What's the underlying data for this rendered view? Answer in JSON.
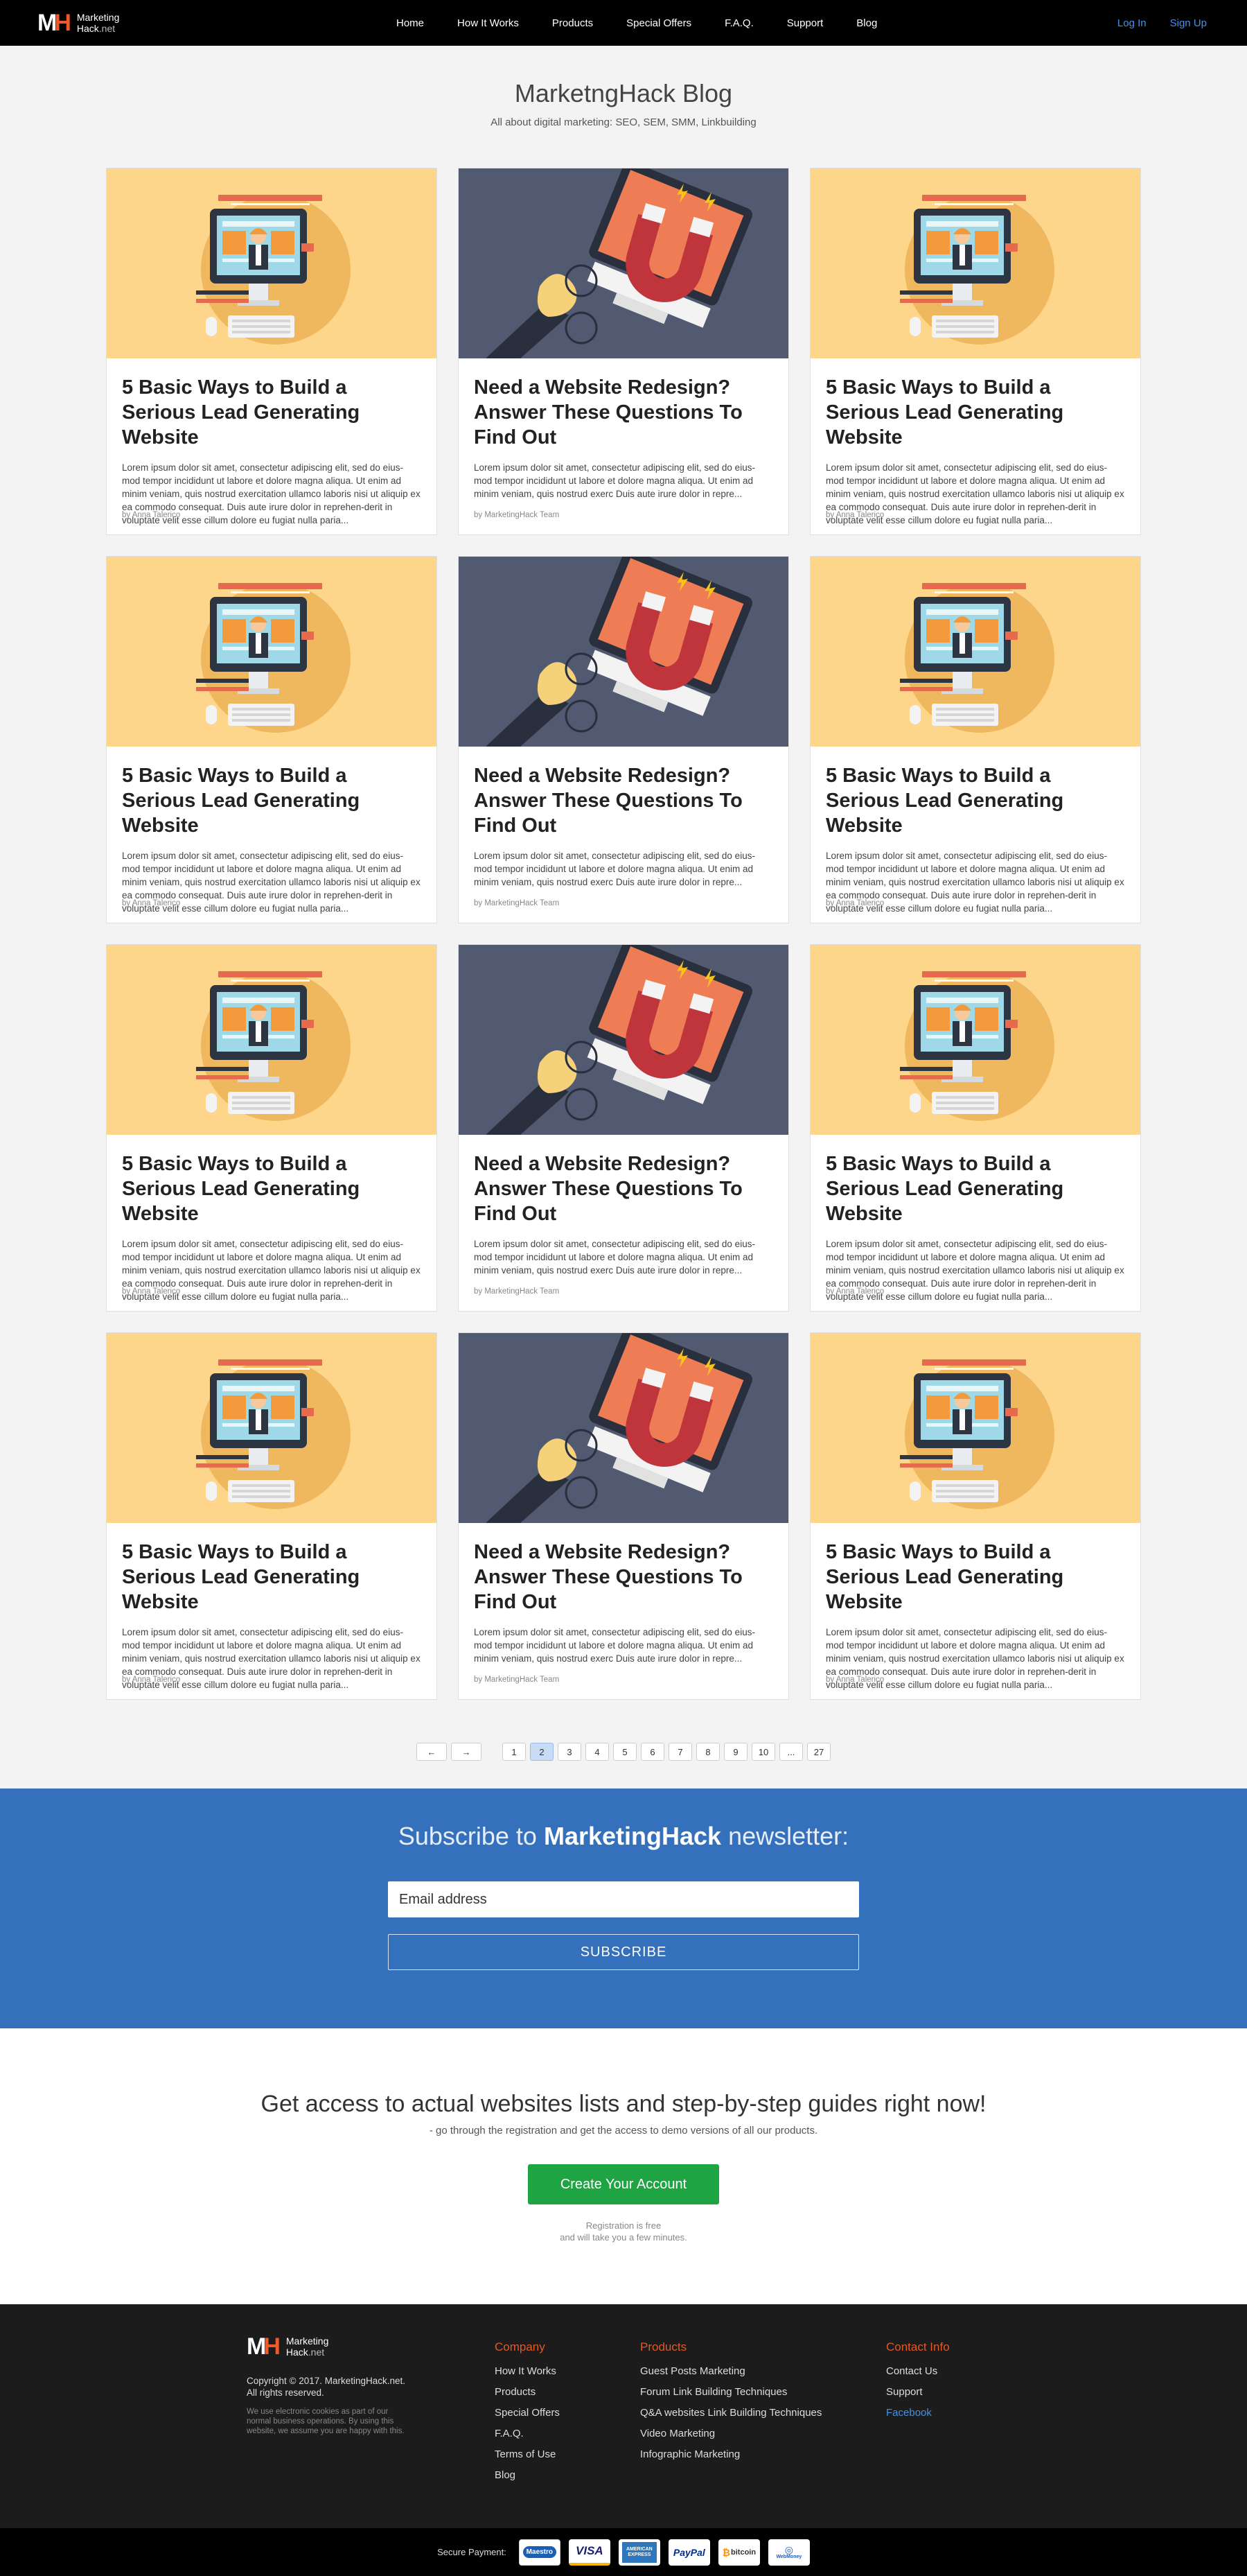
{
  "header": {
    "logo_line1": "Marketing",
    "logo_line2a": "Hack",
    "logo_line2b": ".net",
    "nav": [
      "Home",
      "How It Works",
      "Products",
      "Special Offers",
      "F.A.Q.",
      "Support",
      "Blog"
    ],
    "login": "Log In",
    "signup": "Sign Up"
  },
  "blog": {
    "title": "MarketngHack Blog",
    "subtitle": "All about digital marketing: SEO, SEM, SMM, Linkbuilding"
  },
  "posts": [
    {
      "title": "5 Basic Ways to Build a Serious Lead Generating Website",
      "excerpt": "Lorem ipsum dolor sit amet, consectetur adipiscing elit, sed do eius-mod tempor incididunt ut labore et dolore magna aliqua. Ut enim ad minim veniam, quis nostrud exercitation ullamco laboris nisi ut aliquip ex ea commodo consequat. Duis aute irure dolor in reprehen-derit in voluptate velit esse cillum dolore eu fugiat nulla paria...",
      "author": "by Anna Talerico",
      "image": "developer-illustration"
    },
    {
      "title": "Need a Website Redesign? Answer These Questions To Find Out",
      "excerpt": "Lorem ipsum dolor sit amet, consectetur adipiscing elit, sed do eius-mod tempor incididunt ut labore et dolore magna aliqua. Ut enim ad minim veniam, quis nostrud exerc Duis aute irure dolor in repre...",
      "author": "by MarketingHack Team",
      "image": "magnet-illustration"
    },
    {
      "title": "5 Basic Ways to Build a Serious Lead Generating Website",
      "excerpt": "Lorem ipsum dolor sit amet, consectetur adipiscing elit, sed do eius-mod tempor incididunt ut labore et dolore magna aliqua. Ut enim ad minim veniam, quis nostrud exercitation ullamco laboris nisi ut aliquip ex ea commodo consequat. Duis aute irure dolor in reprehen-derit in voluptate velit esse cillum dolore eu fugiat nulla paria...",
      "author": "by Anna Talerico",
      "image": "developer-illustration"
    },
    {
      "title": "5 Basic Ways to Build a Serious Lead Generating Website",
      "excerpt": "Lorem ipsum dolor sit amet, consectetur adipiscing elit, sed do eius-mod tempor incididunt ut labore et dolore magna aliqua. Ut enim ad minim veniam, quis nostrud exercitation ullamco laboris nisi ut aliquip ex ea commodo consequat. Duis aute irure dolor in reprehen-derit in voluptate velit esse cillum dolore eu fugiat nulla paria...",
      "author": "by Anna Talerico",
      "image": "developer-illustration"
    },
    {
      "title": "Need a Website Redesign? Answer These Questions To Find Out",
      "excerpt": "Lorem ipsum dolor sit amet, consectetur adipiscing elit, sed do eius-mod tempor incididunt ut labore et dolore magna aliqua. Ut enim ad minim veniam, quis nostrud exerc Duis aute irure dolor in repre...",
      "author": "by MarketingHack Team",
      "image": "magnet-illustration"
    },
    {
      "title": "5 Basic Ways to Build a Serious Lead Generating Website",
      "excerpt": "Lorem ipsum dolor sit amet, consectetur adipiscing elit, sed do eius-mod tempor incididunt ut labore et dolore magna aliqua. Ut enim ad minim veniam, quis nostrud exercitation ullamco laboris nisi ut aliquip ex ea commodo consequat. Duis aute irure dolor in reprehen-derit in voluptate velit esse cillum dolore eu fugiat nulla paria...",
      "author": "by Anna Talerico",
      "image": "developer-illustration"
    },
    {
      "title": "5 Basic Ways to Build a Serious Lead Generating Website",
      "excerpt": "Lorem ipsum dolor sit amet, consectetur adipiscing elit, sed do eius-mod tempor incididunt ut labore et dolore magna aliqua. Ut enim ad minim veniam, quis nostrud exercitation ullamco laboris nisi ut aliquip ex ea commodo consequat. Duis aute irure dolor in reprehen-derit in voluptate velit esse cillum dolore eu fugiat nulla paria...",
      "author": "by Anna Talerico",
      "image": "developer-illustration"
    },
    {
      "title": "Need a Website Redesign? Answer These Questions To Find Out",
      "excerpt": "Lorem ipsum dolor sit amet, consectetur adipiscing elit, sed do eius-mod tempor incididunt ut labore et dolore magna aliqua. Ut enim ad minim veniam, quis nostrud exerc Duis aute irure dolor in repre...",
      "author": "by MarketingHack Team",
      "image": "magnet-illustration"
    },
    {
      "title": "5 Basic Ways to Build a Serious Lead Generating Website",
      "excerpt": "Lorem ipsum dolor sit amet, consectetur adipiscing elit, sed do eius-mod tempor incididunt ut labore et dolore magna aliqua. Ut enim ad minim veniam, quis nostrud exercitation ullamco laboris nisi ut aliquip ex ea commodo consequat. Duis aute irure dolor in reprehen-derit in voluptate velit esse cillum dolore eu fugiat nulla paria...",
      "author": "by Anna Talerico",
      "image": "developer-illustration"
    },
    {
      "title": "5 Basic Ways to Build a Serious Lead Generating Website",
      "excerpt": "Lorem ipsum dolor sit amet, consectetur adipiscing elit, sed do eius-mod tempor incididunt ut labore et dolore magna aliqua. Ut enim ad minim veniam, quis nostrud exercitation ullamco laboris nisi ut aliquip ex ea commodo consequat. Duis aute irure dolor in reprehen-derit in voluptate velit esse cillum dolore eu fugiat nulla paria...",
      "author": "by Anna Talerico",
      "image": "developer-illustration"
    },
    {
      "title": "Need a Website Redesign? Answer These Questions To Find Out",
      "excerpt": "Lorem ipsum dolor sit amet, consectetur adipiscing elit, sed do eius-mod tempor incididunt ut labore et dolore magna aliqua. Ut enim ad minim veniam, quis nostrud exerc Duis aute irure dolor in repre...",
      "author": "by MarketingHack Team",
      "image": "magnet-illustration"
    },
    {
      "title": "5 Basic Ways to Build a Serious Lead Generating Website",
      "excerpt": "Lorem ipsum dolor sit amet, consectetur adipiscing elit, sed do eius-mod tempor incididunt ut labore et dolore magna aliqua. Ut enim ad minim veniam, quis nostrud exercitation ullamco laboris nisi ut aliquip ex ea commodo consequat. Duis aute irure dolor in reprehen-derit in voluptate velit esse cillum dolore eu fugiat nulla paria...",
      "author": "by Anna Talerico",
      "image": "developer-illustration"
    }
  ],
  "pagination": {
    "prev": "←",
    "next": "→",
    "pages": [
      "1",
      "2",
      "3",
      "4",
      "5",
      "6",
      "7",
      "8",
      "9",
      "10",
      "...",
      "27"
    ],
    "current": "2"
  },
  "subscribe": {
    "title_pre": "Subscribe to",
    "title_brand": "MarketingHack",
    "title_post": "newsletter:",
    "placeholder": "Email address",
    "button": "SUBSCRIBE"
  },
  "cta": {
    "title": "Get access to actual websites lists and step-by-step guides right now!",
    "subtitle": "- go through the registration and get the access to demo versions of all our products.",
    "button": "Create Your Account",
    "note1": "Registration is free",
    "note2": "and will take you a few minutes."
  },
  "footer": {
    "copyright1": "Copyright © 2017. MarketingHack.net.",
    "copyright2": "All rights reserved.",
    "cookie": "We use electronic cookies as part of our normal business operations. By using this website, we assume you are happy with this.",
    "company_title": "Company",
    "company_links": [
      "How It Works",
      "Products",
      "Special Offers",
      "F.A.Q.",
      "Terms of Use",
      "Blog"
    ],
    "products_title": "Products",
    "products_links": [
      "Guest Posts Marketing",
      "Forum Link Building Techniques",
      "Q&A websites Link Building Techniques",
      "Video Marketing",
      "Infographic Marketing"
    ],
    "contact_title": "Contact Info",
    "contact_links": [
      "Contact Us",
      "Support",
      "Facebook"
    ]
  },
  "payment": {
    "label": "Secure Payment:",
    "methods": [
      "Maestro",
      "VISA",
      "AMERICAN EXPRESS",
      "PayPal",
      "bitcoin",
      "WebMoney"
    ]
  },
  "colors": {
    "accent_orange": "#f05a28",
    "link_blue": "#4a90e2",
    "subscribe_bg": "#3470bc",
    "cta_green": "#1fa444"
  }
}
